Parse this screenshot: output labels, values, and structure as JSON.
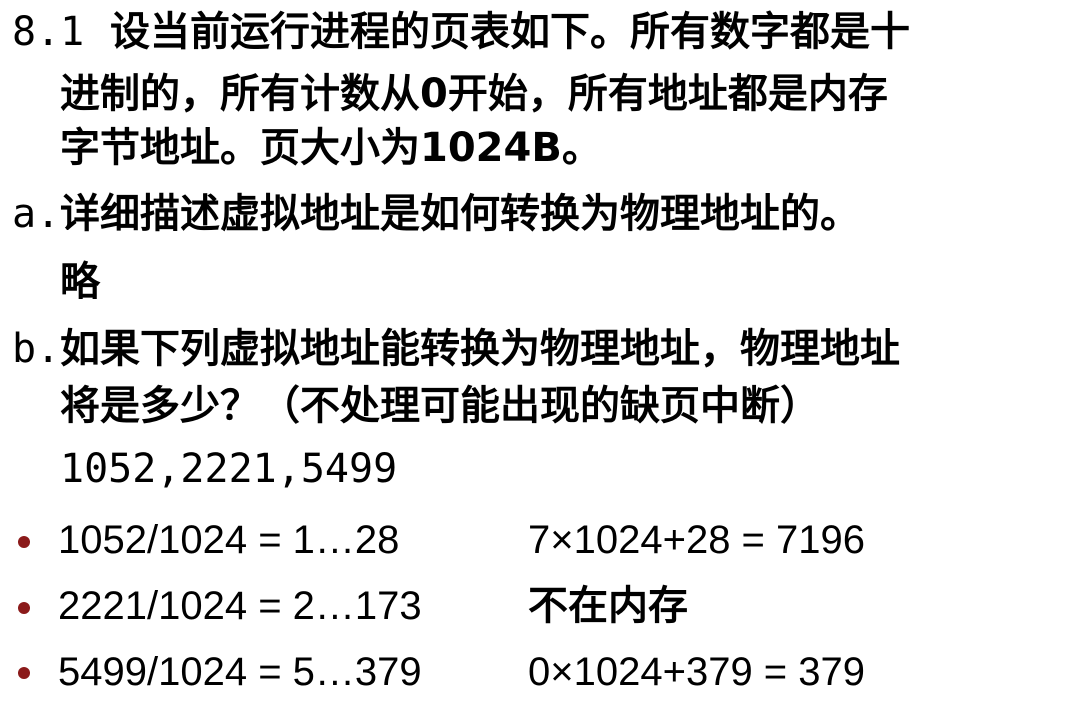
{
  "problem": {
    "number": "8.1",
    "statement_line1": "设当前运行进程的页表如下。所有数字都是十",
    "statement_line2": "进制的，所有计数从0开始，所有地址都是内存",
    "statement_line3": "字节地址。页大小为1024B。"
  },
  "part_a": {
    "label": "a.",
    "question": "详细描述虚拟地址是如何转换为物理地址的。",
    "answer": "略"
  },
  "part_b": {
    "label": "b.",
    "question_line1": "如果下列虚拟地址能转换为物理地址，物理地址",
    "question_line2": "将是多少？（不处理可能出现的缺页中断）",
    "addresses": "1052,2221,5499"
  },
  "results": [
    {
      "division": "1052/1024 = 1…28",
      "outcome": "7×1024+28 = 7196"
    },
    {
      "division": "2221/1024 = 2…173",
      "outcome": "不在内存"
    },
    {
      "division": "5499/1024 = 5…379",
      "outcome": "0×1024+379 = 379"
    }
  ],
  "colors": {
    "bullet": "#8b1a1a",
    "text": "#000000",
    "background": "#ffffff"
  }
}
